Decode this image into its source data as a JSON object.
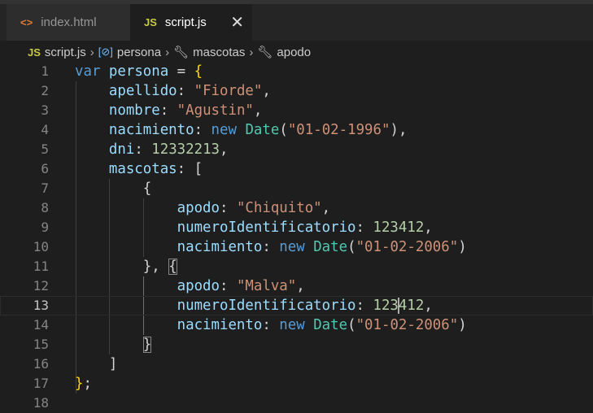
{
  "tabs": [
    {
      "label": "index.html",
      "icon": "<>",
      "color": "#e37933"
    },
    {
      "label": "script.js",
      "icon": "JS",
      "color": "#cbcb41",
      "close": "✕",
      "active": true
    }
  ],
  "breadcrumb": [
    "script.js",
    "persona",
    "mascotas",
    "apodo"
  ],
  "colors": {
    "background": "#1e1e1e",
    "keyword": "#569cd6",
    "property": "#9cdcfe",
    "string": "#ce9178",
    "number": "#b5cea8",
    "class": "#4ec9b0"
  },
  "active_line": 13,
  "lines": [
    [
      [
        "kw",
        "var"
      ],
      [
        "pu",
        " "
      ],
      [
        "prop",
        "persona"
      ],
      [
        "pu",
        " = "
      ],
      [
        "br",
        "{"
      ]
    ],
    [
      [
        "pu",
        "    "
      ],
      [
        "prop",
        "apellido"
      ],
      [
        "pu",
        ": "
      ],
      [
        "str",
        "\"Fiorde\""
      ],
      [
        "pu",
        ","
      ]
    ],
    [
      [
        "pu",
        "    "
      ],
      [
        "prop",
        "nombre"
      ],
      [
        "pu",
        ": "
      ],
      [
        "str",
        "\"Agustin\""
      ],
      [
        "pu",
        ","
      ]
    ],
    [
      [
        "pu",
        "    "
      ],
      [
        "prop",
        "nacimiento"
      ],
      [
        "pu",
        ": "
      ],
      [
        "kw",
        "new"
      ],
      [
        "pu",
        " "
      ],
      [
        "cls",
        "Date"
      ],
      [
        "pu",
        "("
      ],
      [
        "str",
        "\"01-02-1996\""
      ],
      [
        "pu",
        "),"
      ]
    ],
    [
      [
        "pu",
        "    "
      ],
      [
        "prop",
        "dni"
      ],
      [
        "pu",
        ": "
      ],
      [
        "num",
        "12332213"
      ],
      [
        "pu",
        ","
      ]
    ],
    [
      [
        "pu",
        "    "
      ],
      [
        "prop",
        "mascotas"
      ],
      [
        "pu",
        ": "
      ],
      [
        "pu",
        "["
      ]
    ],
    [
      [
        "pu",
        "        "
      ],
      [
        "pu",
        "{"
      ]
    ],
    [
      [
        "pu",
        "            "
      ],
      [
        "prop",
        "apodo"
      ],
      [
        "pu",
        ": "
      ],
      [
        "str",
        "\"Chiquito\""
      ],
      [
        "pu",
        ","
      ]
    ],
    [
      [
        "pu",
        "            "
      ],
      [
        "prop",
        "numeroIdentificatorio"
      ],
      [
        "pu",
        ": "
      ],
      [
        "num",
        "123412"
      ],
      [
        "pu",
        ","
      ]
    ],
    [
      [
        "pu",
        "            "
      ],
      [
        "prop",
        "nacimiento"
      ],
      [
        "pu",
        ": "
      ],
      [
        "kw",
        "new"
      ],
      [
        "pu",
        " "
      ],
      [
        "cls",
        "Date"
      ],
      [
        "pu",
        "("
      ],
      [
        "str",
        "\"01-02-2006\""
      ],
      [
        "pu",
        ")"
      ]
    ],
    [
      [
        "pu",
        "        "
      ],
      [
        "pu",
        "}, "
      ],
      [
        "pu match",
        "{"
      ]
    ],
    [
      [
        "pu",
        "            "
      ],
      [
        "prop",
        "apodo"
      ],
      [
        "pu",
        ": "
      ],
      [
        "str",
        "\"Malva\""
      ],
      [
        "pu",
        ","
      ]
    ],
    [
      [
        "pu",
        "            "
      ],
      [
        "prop",
        "numeroIdentificatorio"
      ],
      [
        "pu",
        ": "
      ],
      [
        "num",
        "123"
      ],
      [
        "cursor",
        ""
      ],
      [
        "num",
        "412"
      ],
      [
        "pu",
        ","
      ]
    ],
    [
      [
        "pu",
        "            "
      ],
      [
        "prop",
        "nacimiento"
      ],
      [
        "pu",
        ": "
      ],
      [
        "kw",
        "new"
      ],
      [
        "pu",
        " "
      ],
      [
        "cls",
        "Date"
      ],
      [
        "pu",
        "("
      ],
      [
        "str",
        "\"01-02-2006\""
      ],
      [
        "pu",
        ")"
      ]
    ],
    [
      [
        "pu",
        "        "
      ],
      [
        "pu match",
        "}"
      ]
    ],
    [
      [
        "pu",
        "    "
      ],
      [
        "pu",
        "]"
      ]
    ],
    [
      [
        "br",
        "}"
      ],
      [
        "pu",
        ";"
      ]
    ],
    []
  ]
}
